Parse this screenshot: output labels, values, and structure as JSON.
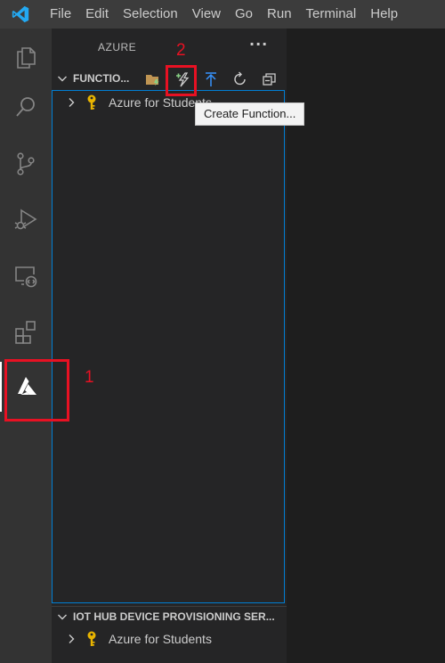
{
  "menu": [
    "File",
    "Edit",
    "Selection",
    "View",
    "Go",
    "Run",
    "Terminal",
    "Help"
  ],
  "sidebar": {
    "title": "AZURE",
    "more": "···",
    "functions_section": {
      "label": "FUNCTIO...",
      "items": [
        {
          "label": "Azure for Students"
        }
      ]
    },
    "iot_section": {
      "label": "IOT HUB DEVICE PROVISIONING SER...",
      "items": [
        {
          "label": "Azure for Students"
        }
      ]
    }
  },
  "tooltip": "Create Function...",
  "annotations": {
    "one": "1",
    "two": "2",
    "color": "#e81123"
  },
  "colors": {
    "titlebar": "#3c3c3c",
    "activitybar": "#333333",
    "sidebar": "#252526",
    "editor": "#1e1e1e",
    "focus": "#007fd4",
    "lightning": "#89d185",
    "key": "#e8b400"
  },
  "icons": {
    "logo": "vscode-logo-icon",
    "activity": [
      "explorer-icon",
      "search-icon",
      "source-control-icon",
      "run-debug-icon",
      "remote-explorer-icon",
      "extensions-icon",
      "azure-icon"
    ],
    "toolbar": [
      "create-project-icon",
      "create-function-icon",
      "deploy-icon",
      "refresh-icon",
      "collapse-all-icon"
    ]
  }
}
